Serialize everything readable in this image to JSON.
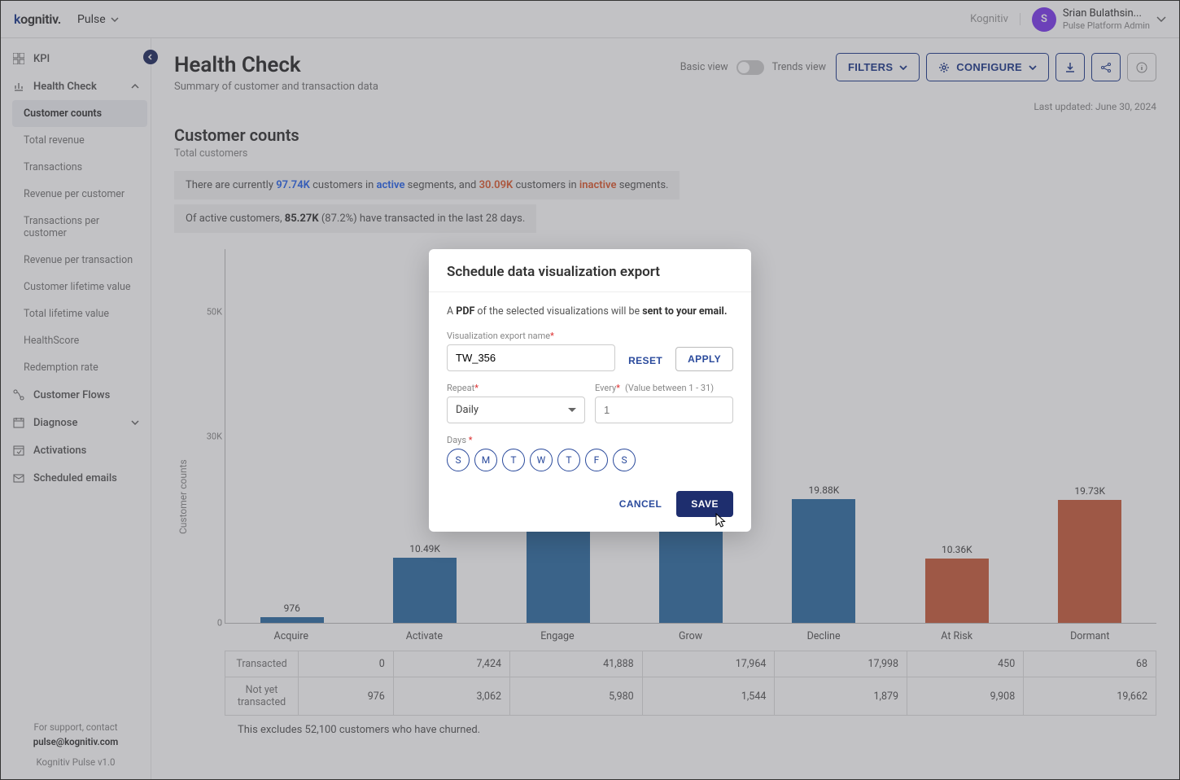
{
  "header": {
    "logo": "kognitiv.",
    "appname": "Pulse",
    "org": "Kognitiv",
    "avatar_initial": "S",
    "username": "Srian Bulathsin...",
    "role": "Pulse Platform Admin"
  },
  "sidebar": {
    "items": [
      {
        "label": "KPI",
        "icon": "grid"
      },
      {
        "label": "Health Check",
        "icon": "chart",
        "expanded": true,
        "children": [
          "Customer counts",
          "Total revenue",
          "Transactions",
          "Revenue per customer",
          "Transactions per customer",
          "Revenue per transaction",
          "Customer lifetime value",
          "Total lifetime value",
          "HealthScore",
          "Redemption rate"
        ],
        "active_child": 0
      },
      {
        "label": "Customer Flows",
        "icon": "flow"
      },
      {
        "label": "Diagnose",
        "icon": "calendar",
        "expandable": true
      },
      {
        "label": "Activations",
        "icon": "calendar2"
      },
      {
        "label": "Scheduled emails",
        "icon": "mail"
      }
    ],
    "footer": {
      "line1": "For support, contact",
      "email": "pulse@kognitiv.com",
      "version": "Kognitiv Pulse v1.0"
    }
  },
  "page": {
    "title": "Health Check",
    "subtitle": "Summary of customer and transaction data",
    "basic_view": "Basic view",
    "trends_view": "Trends view",
    "filters": "FILTERS",
    "configure": "CONFIGURE",
    "last_updated": "Last updated: June 30, 2024"
  },
  "section": {
    "title": "Customer counts",
    "subtitle": "Total customers",
    "info1_a": "There are currently ",
    "info1_b": "97.74K",
    "info1_c": " customers in ",
    "info1_d": "active",
    "info1_e": " segments, and ",
    "info1_f": "30.09K",
    "info1_g": " customers in ",
    "info1_h": "inactive",
    "info1_i": " segments.",
    "info2_a": "Of active customers, ",
    "info2_b": "85.27K",
    "info2_c": " (87.2%) have transacted in the last 28 days."
  },
  "chart_data": {
    "type": "bar",
    "ylabel": "Customer counts",
    "ylim": [
      0,
      60000
    ],
    "yticks": [
      0,
      30000,
      50000
    ],
    "ytick_labels": [
      "0",
      "30K",
      "50K"
    ],
    "categories": [
      "Acquire",
      "Activate",
      "Engage",
      "Grow",
      "Decline",
      "At Risk",
      "Dormant"
    ],
    "values": [
      976,
      10490,
      47868,
      19508,
      19880,
      10360,
      19730
    ],
    "value_labels": [
      "976",
      "10.49K",
      "",
      "",
      "19.88K",
      "10.36K",
      "19.73K"
    ],
    "colors": [
      "blue",
      "blue",
      "blue",
      "blue",
      "blue",
      "red",
      "red"
    ]
  },
  "table": {
    "rows": [
      {
        "label": "Transacted",
        "cells": [
          "0",
          "7,424",
          "41,888",
          "17,964",
          "17,998",
          "450",
          "68"
        ]
      },
      {
        "label": "Not yet transacted",
        "cells": [
          "976",
          "3,062",
          "5,980",
          "1,544",
          "1,879",
          "9,908",
          "19,662"
        ]
      }
    ],
    "footnote": "This excludes 52,100 customers who have churned."
  },
  "modal": {
    "title": "Schedule data visualization export",
    "desc_a": "A ",
    "desc_b": "PDF",
    "desc_c": " of the selected visualizations will be ",
    "desc_d": "sent to your email.",
    "name_label": "Visualization export name",
    "name_value": "TW_356",
    "reset": "RESET",
    "apply": "APPLY",
    "repeat_label": "Repeat",
    "repeat_value": "Daily",
    "every_label": "Every",
    "every_hint": "(Value between 1 - 31)",
    "every_value": "1",
    "days_label": "Days",
    "days": [
      "S",
      "M",
      "T",
      "W",
      "T",
      "F",
      "S"
    ],
    "cancel": "CANCEL",
    "save": "SAVE"
  }
}
